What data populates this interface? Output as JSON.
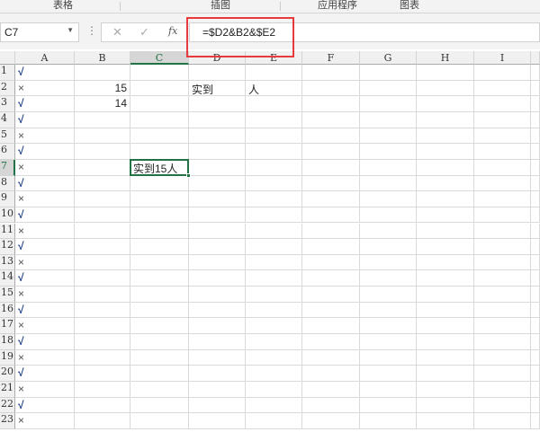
{
  "ribbon_groups": [
    "表格",
    "插图",
    "应用程序",
    "图表"
  ],
  "formula_bar": {
    "name_box": "C7",
    "cancel_icon": "✕",
    "enter_icon": "✓",
    "fx_label": "fx",
    "formula": "=$D2&B2&$E2"
  },
  "columns": [
    "A",
    "B",
    "C",
    "D",
    "E",
    "F",
    "G",
    "H",
    "I"
  ],
  "selected_column": "C",
  "selected_row": 7,
  "rows": [
    {
      "n": "1",
      "A": "√"
    },
    {
      "n": "2",
      "A": "×",
      "B": "15",
      "D": "实到",
      "E": "人"
    },
    {
      "n": "3",
      "A": "√",
      "B": "14"
    },
    {
      "n": "4",
      "A": "√"
    },
    {
      "n": "5",
      "A": "×"
    },
    {
      "n": "6",
      "A": "√"
    },
    {
      "n": "7",
      "A": "×",
      "C": "实到15人"
    },
    {
      "n": "8",
      "A": "√"
    },
    {
      "n": "9",
      "A": "×"
    },
    {
      "n": "10",
      "A": "√"
    },
    {
      "n": "11",
      "A": "×"
    },
    {
      "n": "12",
      "A": "√"
    },
    {
      "n": "13",
      "A": "×"
    },
    {
      "n": "14",
      "A": "√"
    },
    {
      "n": "15",
      "A": "×"
    },
    {
      "n": "16",
      "A": "√"
    },
    {
      "n": "17",
      "A": "×"
    },
    {
      "n": "18",
      "A": "√"
    },
    {
      "n": "19",
      "A": "×"
    },
    {
      "n": "20",
      "A": "√"
    },
    {
      "n": "21",
      "A": "×"
    },
    {
      "n": "22",
      "A": "√"
    },
    {
      "n": "23",
      "A": "×"
    }
  ]
}
